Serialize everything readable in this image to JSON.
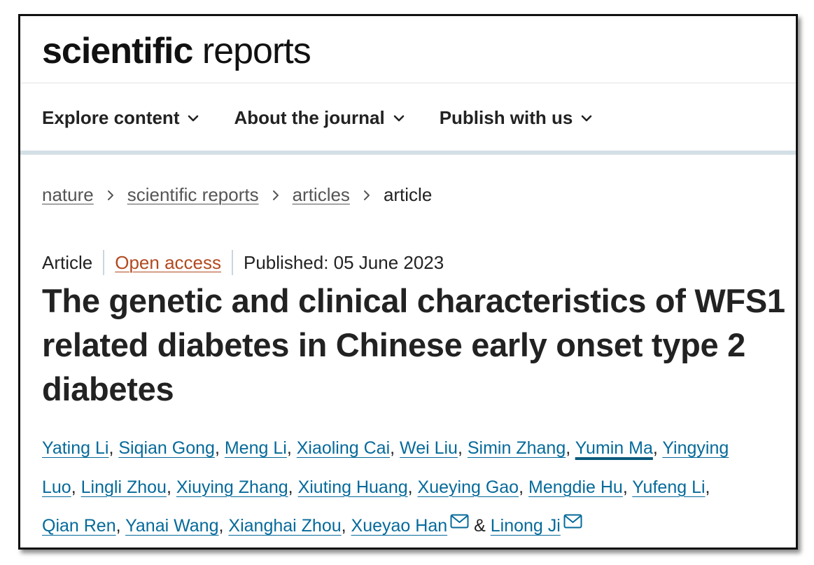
{
  "brand": {
    "bold": "scientific",
    "light": "reports"
  },
  "nav": [
    {
      "label": "Explore content"
    },
    {
      "label": "About the journal"
    },
    {
      "label": "Publish with us"
    }
  ],
  "breadcrumb": [
    {
      "label": "nature"
    },
    {
      "label": "scientific reports"
    },
    {
      "label": "articles"
    },
    {
      "label": "article"
    }
  ],
  "article_meta": {
    "type": "Article",
    "access": "Open access",
    "published": "Published: 05 June 2023"
  },
  "title": "The genetic and clinical characteristics of WFS1 related diabetes in Chinese early onset type 2 diabetes",
  "authors": {
    "line1": [
      "Yating Li",
      "Siqian Gong",
      "Meng Li",
      "Xiaoling Cai",
      "Wei Liu",
      "Simin Zhang",
      "Yumin Ma",
      "Yingying"
    ],
    "line2": [
      "Luo",
      "Lingli Zhou",
      "Xiuying Zhang",
      "Xiuting Huang",
      "Xueying Gao",
      "Mengdie Hu",
      "Yufeng Li"
    ],
    "line3": [
      "Qian Ren",
      "Yanai Wang",
      "Xianghai Zhou",
      "Xueyao Han",
      "Linong Ji"
    ],
    "separator": ", ",
    "ampersand": "&"
  },
  "colors": {
    "link": "#066a9a",
    "open_access": "#b24a1f",
    "nav_bar": "#d3e0e5"
  },
  "icons": {
    "nav_toggle": "chevron-down-icon",
    "breadcrumb_separator": "chevron-right-icon",
    "corresponding_author": "mail-icon"
  }
}
